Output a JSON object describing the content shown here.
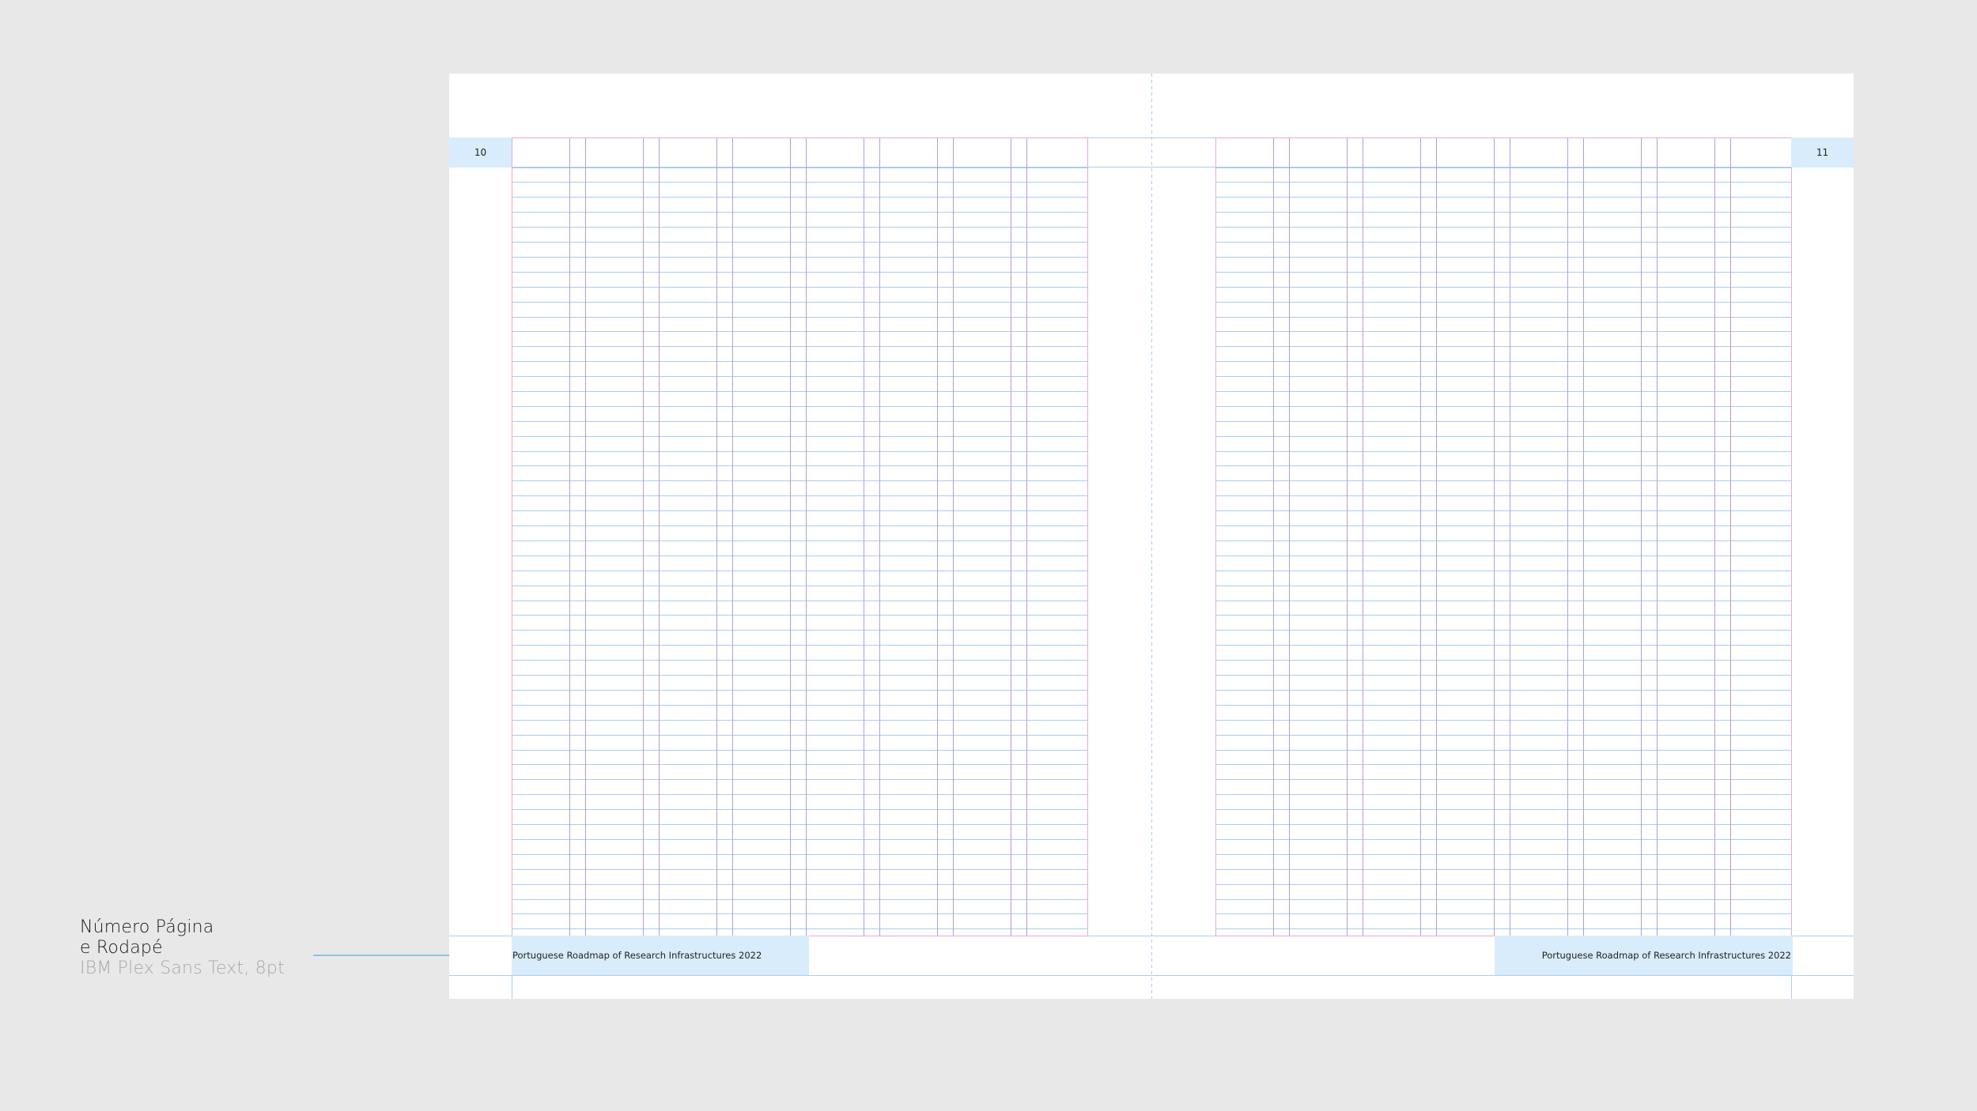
{
  "annotation": {
    "line1": "Número Página",
    "line2": "e Rodapé",
    "line3": "IBM Plex Sans Text, 8pt"
  },
  "spread": {
    "left_page": {
      "page_number": "10",
      "footer": "Portuguese Roadmap of Research Infrastructures 2022"
    },
    "right_page": {
      "page_number": "11",
      "footer": "Portuguese Roadmap of Research Infrastructures 2022"
    }
  },
  "colors": {
    "canvas": "#e8e8e8",
    "page": "#ffffff",
    "highlight": "#d8ecfb",
    "baseline_grid": "#a9cdee",
    "column_guides": "#b59adf",
    "margin_guides": "#e8a8d8"
  }
}
